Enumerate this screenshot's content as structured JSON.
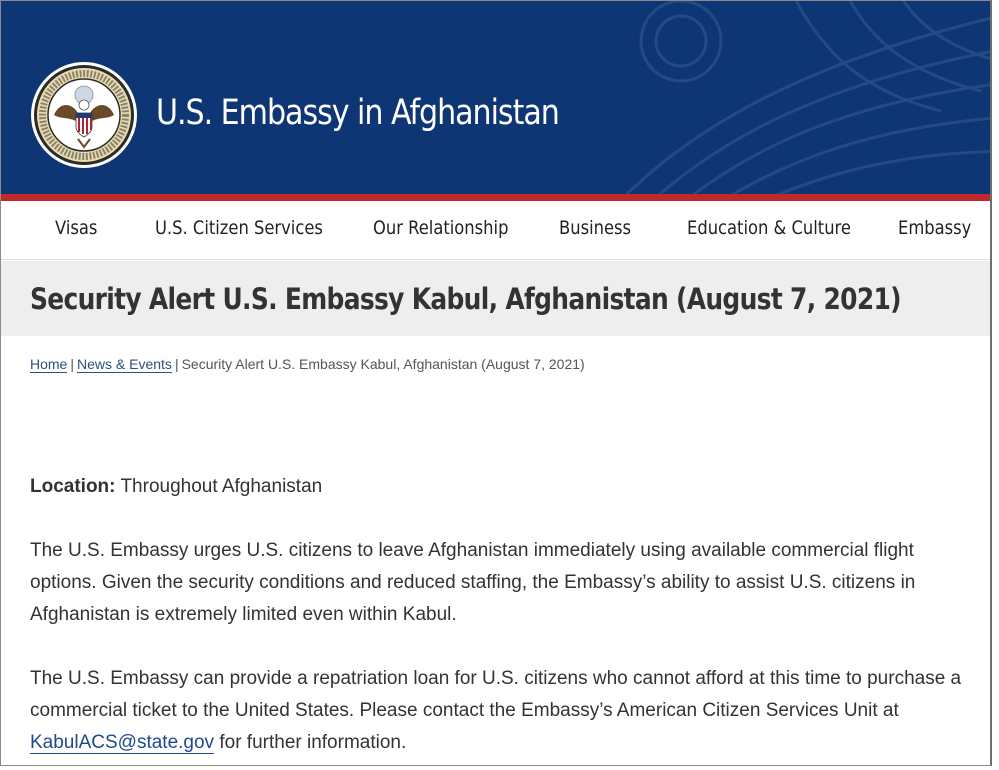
{
  "header": {
    "site_title": "U.S. Embassy in Afghanistan",
    "seal_ring_text_top": "DEPARTMENT OF STATE",
    "seal_ring_text_bottom": "UNITED STATES OF AMERICA",
    "brand_color": "#0f3674",
    "accent_color": "#c0282d"
  },
  "nav": {
    "items": [
      {
        "label": "Visas"
      },
      {
        "label": "U.S. Citizen Services"
      },
      {
        "label": "Our Relationship"
      },
      {
        "label": "Business"
      },
      {
        "label": "Education & Culture"
      },
      {
        "label": "Embassy"
      }
    ]
  },
  "page": {
    "title": "Security Alert U.S. Embassy Kabul, Afghanistan (August 7, 2021)"
  },
  "breadcrumb": {
    "home": "Home",
    "section": "News & Events",
    "separator": "|",
    "current": "Security Alert U.S. Embassy Kabul, Afghanistan (August 7, 2021)"
  },
  "content": {
    "location_label": "Location:",
    "location_value": "Throughout Afghanistan",
    "paragraph_1": "The U.S. Embassy urges U.S. citizens to leave Afghanistan immediately using available commercial flight options.  Given the security conditions and reduced staffing, the Embassy’s ability to assist U.S. citizens in Afghanistan is extremely limited even within Kabul.",
    "paragraph_2_before": "The U.S. Embassy can provide a repatriation loan for U.S. citizens who cannot afford at this time to purchase a commercial ticket to the United States.  Please contact the Embassy’s American Citizen Services Unit at",
    "email_link": "KabulACS@state.gov",
    "paragraph_2_after": "for further information."
  },
  "icons": {
    "seal": "department-of-state-seal-icon",
    "watermark": "eagle-wing-watermark-icon"
  }
}
